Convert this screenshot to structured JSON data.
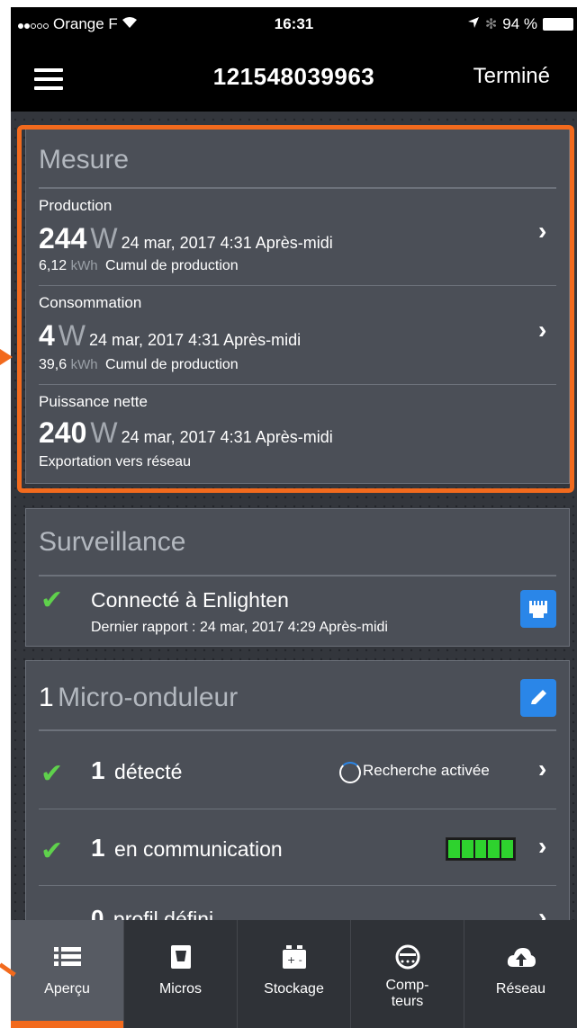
{
  "status_bar": {
    "carrier": "Orange F",
    "time": "16:31",
    "battery": "94 %"
  },
  "nav": {
    "title": "121548039963",
    "done": "Terminé"
  },
  "mesure": {
    "title": "Mesure",
    "production": {
      "label": "Production",
      "value": "244",
      "unit": "W",
      "date": "24 mar, 2017 4:31 Après-midi",
      "kwh": "6,12",
      "kwh_unit": "kWh",
      "kwh_label": "Cumul de production"
    },
    "consommation": {
      "label": "Consommation",
      "value": "4",
      "unit": "W",
      "date": "24 mar, 2017 4:31 Après-midi",
      "kwh": "39,6",
      "kwh_unit": "kWh",
      "kwh_label": "Cumul de production"
    },
    "nette": {
      "label": "Puissance nette",
      "value": "240",
      "unit": "W",
      "date": "24 mar, 2017 4:31 Après-midi",
      "sub": "Exportation vers réseau"
    }
  },
  "surveillance": {
    "title": "Surveillance",
    "connected": "Connecté à Enlighten",
    "last_report": "Dernier rapport : 24 mar, 2017 4:29 Après-midi"
  },
  "micro": {
    "count": "1",
    "title": "Micro-onduleur",
    "detected_count": "1",
    "detected_label": "détecté",
    "search": "Recherche activée",
    "comm_count": "1",
    "comm_label": "en communication",
    "profile_count": "0",
    "profile_label": "profil défini"
  },
  "tabs": [
    {
      "label": "Aperçu"
    },
    {
      "label": "Micros"
    },
    {
      "label": "Stockage"
    },
    {
      "label": "Comp-\nteurs"
    },
    {
      "label": "Réseau"
    }
  ],
  "colors": {
    "accent": "#f26a1d",
    "check": "#5fd14c",
    "button": "#2a86e8"
  }
}
